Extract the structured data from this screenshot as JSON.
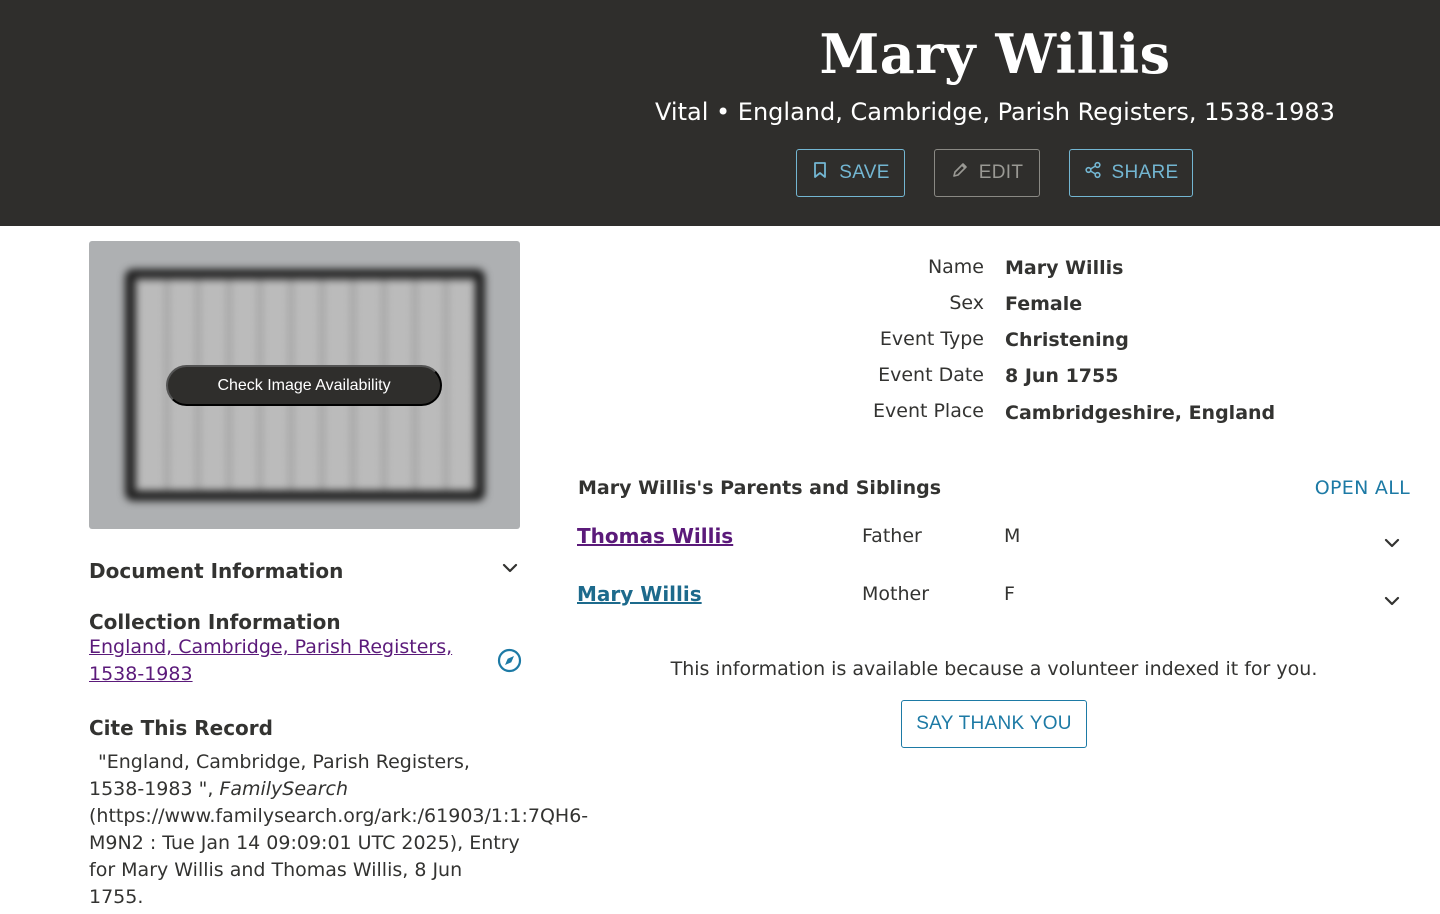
{
  "header": {
    "title": "Mary Willis",
    "subtitle": "Vital • England, Cambridge, Parish Registers, 1538-1983",
    "save_label": "SAVE",
    "edit_label": "EDIT",
    "share_label": "SHARE"
  },
  "image_panel": {
    "check_label": "Check Image Availability"
  },
  "document_info": {
    "heading": "Document Information"
  },
  "collection": {
    "heading": "Collection Information",
    "link_text": "England, Cambridge, Parish Registers, 1538-1983"
  },
  "citation": {
    "heading": "Cite This Record",
    "text_before": "\"England, Cambridge, Parish Registers, 1538-1983 \", ",
    "source": "FamilySearch",
    "text_after": " (https://www.familysearch.org/ark:/61903/1:1:7QH6-M9N2 : Tue Jan 14 09:09:01 UTC 2025), Entry for Mary Willis and Thomas Willis, 8 Jun 1755."
  },
  "facts": [
    {
      "label": "Name",
      "value": "Mary Willis"
    },
    {
      "label": "Sex",
      "value": "Female"
    },
    {
      "label": "Event Type",
      "value": "Christening"
    },
    {
      "label": "Event Date",
      "value": "8 Jun 1755"
    },
    {
      "label": "Event Place",
      "value": "Cambridgeshire, England"
    }
  ],
  "relatives": {
    "heading": "Mary Willis's Parents and Siblings",
    "open_all": "OPEN ALL",
    "people": [
      {
        "name": "Thomas Willis",
        "role": "Father",
        "sex": "M"
      },
      {
        "name": "Mary Willis",
        "role": "Mother",
        "sex": "F"
      }
    ]
  },
  "volunteer": {
    "message": "This information is available because a volunteer indexed it for you.",
    "thanks_label": "SAY THANK YOU"
  },
  "colors": {
    "header_bg": "#2f2e2c",
    "accent": "#1d7aa5",
    "visited_link": "#5b1a7a"
  }
}
